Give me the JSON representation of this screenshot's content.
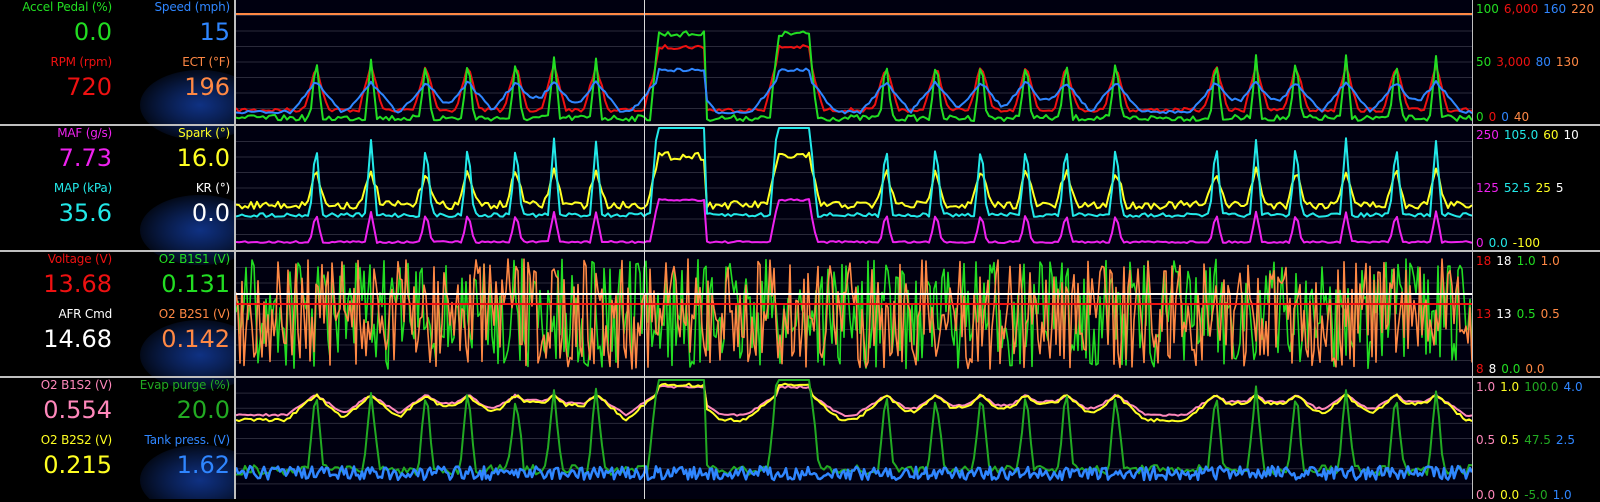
{
  "panels": [
    {
      "params": [
        {
          "label": "Accel Pedal (%)",
          "value": "0.0",
          "label_color": "#22dd22",
          "value_color": "#22dd22"
        },
        {
          "label": "Speed (mph)",
          "value": "15",
          "label_color": "#2f86ff",
          "value_color": "#2f86ff"
        },
        {
          "label": "RPM (rpm)",
          "value": "720",
          "label_color": "#ee1111",
          "value_color": "#ee1111"
        },
        {
          "label": "ECT (°F)",
          "value": "196",
          "label_color": "#ff8844",
          "value_color": "#ff8844"
        }
      ],
      "scale_top": [
        {
          "t": "100",
          "c": "#22dd22"
        },
        {
          "t": "6,000",
          "c": "#ee1111"
        },
        {
          "t": "160",
          "c": "#2f86ff"
        },
        {
          "t": "220",
          "c": "#ff8844"
        }
      ],
      "scale_mid": [
        {
          "t": "50",
          "c": "#22dd22"
        },
        {
          "t": "3,000",
          "c": "#ee1111"
        },
        {
          "t": "80",
          "c": "#2f86ff"
        },
        {
          "t": "130",
          "c": "#ff8844"
        }
      ],
      "scale_bot": [
        {
          "t": "0",
          "c": "#22dd22"
        },
        {
          "t": "0",
          "c": "#ee1111"
        },
        {
          "t": "0",
          "c": "#2f86ff"
        },
        {
          "t": "40",
          "c": "#ff8844"
        }
      ]
    },
    {
      "params": [
        {
          "label": "MAF (g/s)",
          "value": "7.73",
          "label_color": "#ee22ee",
          "value_color": "#ee22ee"
        },
        {
          "label": "Spark (°)",
          "value": "16.0",
          "label_color": "#ffff22",
          "value_color": "#ffff22"
        },
        {
          "label": "MAP (kPa)",
          "value": "35.6",
          "label_color": "#22e8e8",
          "value_color": "#22e8e8"
        },
        {
          "label": "KR (°)",
          "value": "0.0",
          "label_color": "#ffffff",
          "value_color": "#ffffff"
        }
      ],
      "scale_top": [
        {
          "t": "250",
          "c": "#ee22ee"
        },
        {
          "t": "105.0",
          "c": "#22e8e8"
        },
        {
          "t": "60",
          "c": "#ffff22"
        },
        {
          "t": "10",
          "c": "#ffffff"
        }
      ],
      "scale_mid": [
        {
          "t": "125",
          "c": "#ee22ee"
        },
        {
          "t": "52.5",
          "c": "#22e8e8"
        },
        {
          "t": "25",
          "c": "#ffff22"
        },
        {
          "t": "5",
          "c": "#ffffff"
        }
      ],
      "scale_bot": [
        {
          "t": "0",
          "c": "#ee22ee"
        },
        {
          "t": "0.0",
          "c": "#22e8e8"
        },
        {
          "t": "-100",
          "c": "#ffff22"
        },
        {
          "t": "",
          "c": "#ffffff"
        }
      ]
    },
    {
      "params": [
        {
          "label": "Voltage (V)",
          "value": "13.68",
          "label_color": "#ee1111",
          "value_color": "#ee1111"
        },
        {
          "label": "O2 B1S1 (V)",
          "value": "0.131",
          "label_color": "#22dd22",
          "value_color": "#22dd22"
        },
        {
          "label": "AFR Cmd",
          "value": "14.68",
          "label_color": "#ffffff",
          "value_color": "#ffffff"
        },
        {
          "label": "O2 B2S1 (V)",
          "value": "0.142",
          "label_color": "#ff8844",
          "value_color": "#ff8844"
        }
      ],
      "scale_top": [
        {
          "t": "18",
          "c": "#ee1111"
        },
        {
          "t": "18",
          "c": "#ffffff"
        },
        {
          "t": "1.0",
          "c": "#22dd22"
        },
        {
          "t": "1.0",
          "c": "#ff8844"
        }
      ],
      "scale_mid": [
        {
          "t": "13",
          "c": "#ee1111"
        },
        {
          "t": "13",
          "c": "#ffffff"
        },
        {
          "t": "0.5",
          "c": "#22dd22"
        },
        {
          "t": "0.5",
          "c": "#ff8844"
        }
      ],
      "scale_bot": [
        {
          "t": "8",
          "c": "#ee1111"
        },
        {
          "t": "8",
          "c": "#ffffff"
        },
        {
          "t": "0.0",
          "c": "#22dd22"
        },
        {
          "t": "0.0",
          "c": "#ff8844"
        }
      ]
    },
    {
      "params": [
        {
          "label": "O2 B1S2 (V)",
          "value": "0.554",
          "label_color": "#ff88bb",
          "value_color": "#ff88bb"
        },
        {
          "label": "Evap purge (%)",
          "value": "20.0",
          "label_color": "#22aa22",
          "value_color": "#22aa22"
        },
        {
          "label": "O2 B2S2 (V)",
          "value": "0.215",
          "label_color": "#ffff22",
          "value_color": "#ffff22"
        },
        {
          "label": "Tank press. (V)",
          "value": "1.62",
          "label_color": "#2f86ff",
          "value_color": "#2f86ff"
        }
      ],
      "scale_top": [
        {
          "t": "1.0",
          "c": "#ff88bb"
        },
        {
          "t": "1.0",
          "c": "#ffff22"
        },
        {
          "t": "100.0",
          "c": "#22aa22"
        },
        {
          "t": "4.0",
          "c": "#2f86ff"
        }
      ],
      "scale_mid": [
        {
          "t": "0.5",
          "c": "#ff88bb"
        },
        {
          "t": "0.5",
          "c": "#ffff22"
        },
        {
          "t": "47.5",
          "c": "#22aa22"
        },
        {
          "t": "2.5",
          "c": "#2f86ff"
        }
      ],
      "scale_bot": [
        {
          "t": "0.0",
          "c": "#ff88bb"
        },
        {
          "t": "0.0",
          "c": "#ffff22"
        },
        {
          "t": "-5.0",
          "c": "#22aa22"
        },
        {
          "t": "1.0",
          "c": "#2f86ff"
        }
      ]
    }
  ]
}
